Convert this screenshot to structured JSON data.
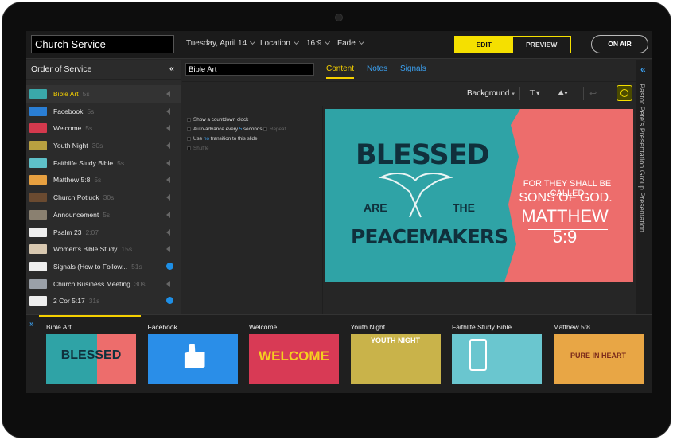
{
  "header": {
    "service_title": "Church Service",
    "date": "Tuesday, April 14",
    "location": "Location",
    "aspect": "16:9",
    "transition": "Fade",
    "edit": "EDIT",
    "preview": "PREVIEW",
    "on_air": "ON AIR"
  },
  "order": {
    "title": "Order of Service",
    "items": [
      {
        "name": "Bible Art",
        "duration": "5s",
        "thumb": "#3aa8aa"
      },
      {
        "name": "Facebook",
        "duration": "5s",
        "thumb": "#2a7ed4"
      },
      {
        "name": "Welcome",
        "duration": "5s",
        "thumb": "#d4394d"
      },
      {
        "name": "Youth Night",
        "duration": "30s",
        "thumb": "#b8a040"
      },
      {
        "name": "Faithlife Study Bible",
        "duration": "5s",
        "thumb": "#5ec0c8"
      },
      {
        "name": "Matthew 5:8",
        "duration": "5s",
        "thumb": "#e7a040"
      },
      {
        "name": "Church Potluck",
        "duration": "30s",
        "thumb": "#6a4a30"
      },
      {
        "name": "Announcement",
        "duration": "5s",
        "thumb": "#8a8070"
      },
      {
        "name": "Psalm 23",
        "duration": "2:07",
        "thumb": "#eeeeee"
      },
      {
        "name": "Women's Bible Study",
        "duration": "15s",
        "thumb": "#d8c8b0"
      },
      {
        "name": "Signals (How to Follow...",
        "duration": "51s",
        "thumb": "#eeeeee"
      },
      {
        "name": "Church Business Meeting",
        "duration": "30s",
        "thumb": "#9aa0a8"
      },
      {
        "name": "2 Cor 5:17",
        "duration": "31s",
        "thumb": "#eeeeee"
      }
    ]
  },
  "editor": {
    "slide_name": "Bible Art",
    "tabs": [
      "Content",
      "Notes",
      "Signals"
    ],
    "background_label": "Background",
    "options": {
      "countdown": "Show a countdown clock",
      "auto_advance_prefix": "Auto-advance every",
      "auto_advance_value": "5",
      "auto_advance_suffix": "seconds",
      "repeat": "Repeat",
      "transition_prefix": "Use",
      "transition_value": "no",
      "transition_suffix": "transition to this slide",
      "shuffle": "Shuffle"
    }
  },
  "slide": {
    "blessed": "BLESSED",
    "are": "ARE",
    "the": "THE",
    "peacemakers": "PEACEMAKERS",
    "line1": "FOR THEY SHALL BE CALLED",
    "line2": "SONS OF GOD.",
    "line3": "MATTHEW 5:9"
  },
  "presentation_name": "Pastor Pete's Presentation Group Presentation",
  "filmstrip": [
    {
      "label": "Bible Art",
      "bg": "#2fa3a6",
      "text": "BLESSED",
      "text_color": "#10303c"
    },
    {
      "label": "Facebook",
      "bg": "#2a8ee8",
      "text": "",
      "text_color": "#ffffff"
    },
    {
      "label": "Welcome",
      "bg": "#d83a55",
      "text": "WELCOME",
      "text_color": "#f5d020"
    },
    {
      "label": "Youth Night",
      "bg": "#c9b34a",
      "text": "YOUTH NIGHT",
      "text_color": "#ffffff"
    },
    {
      "label": "Faithlife Study Bible",
      "bg": "#6ac6cf",
      "text": "",
      "text_color": "#ffffff"
    },
    {
      "label": "Matthew 5:8",
      "bg": "#e8a645",
      "text": "PURE IN HEART",
      "text_color": "#7a2a1a"
    }
  ]
}
